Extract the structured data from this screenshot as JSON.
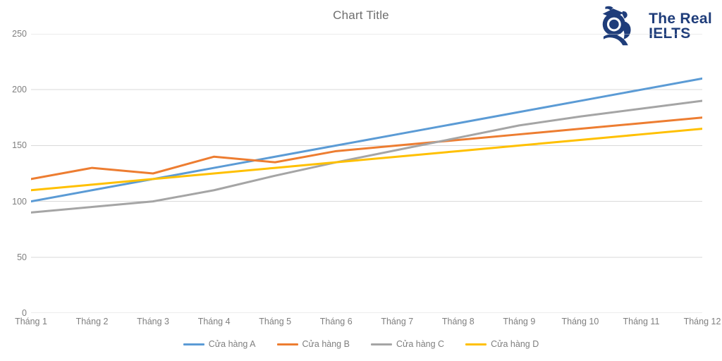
{
  "chart_data": {
    "type": "line",
    "title": "Chart Title",
    "xlabel": "",
    "ylabel": "",
    "ylim": [
      0,
      250
    ],
    "ytick_step": 50,
    "yticks": [
      250,
      200,
      150,
      100,
      50,
      0
    ],
    "grid": true,
    "legend_position": "bottom",
    "categories": [
      "Tháng 1",
      "Tháng 2",
      "Tháng 3",
      "Tháng 4",
      "Tháng 5",
      "Tháng 6",
      "Tháng 7",
      "Tháng 8",
      "Tháng 9",
      "Tháng 10",
      "Tháng 11",
      "Tháng 12"
    ],
    "series": [
      {
        "name": "Cửa hàng A",
        "color": "#5B9BD5",
        "values": [
          100,
          110,
          120,
          130,
          140,
          150,
          160,
          170,
          180,
          190,
          200,
          210
        ]
      },
      {
        "name": "Cửa hàng B",
        "color": "#ED7D31",
        "values": [
          120,
          130,
          125,
          140,
          135,
          145,
          150,
          155,
          160,
          165,
          170,
          175
        ]
      },
      {
        "name": "Cửa hàng C",
        "color": "#A5A5A5",
        "values": [
          90,
          95,
          100,
          110,
          123,
          135,
          146,
          157,
          168,
          176,
          183,
          190
        ]
      },
      {
        "name": "Cửa hàng D",
        "color": "#FFC000",
        "values": [
          110,
          115,
          120,
          125,
          130,
          135,
          140,
          145,
          150,
          155,
          160,
          165
        ]
      }
    ]
  },
  "logo": {
    "line1": "The Real",
    "line2": "IELTS",
    "color": "#1F3D7A"
  }
}
